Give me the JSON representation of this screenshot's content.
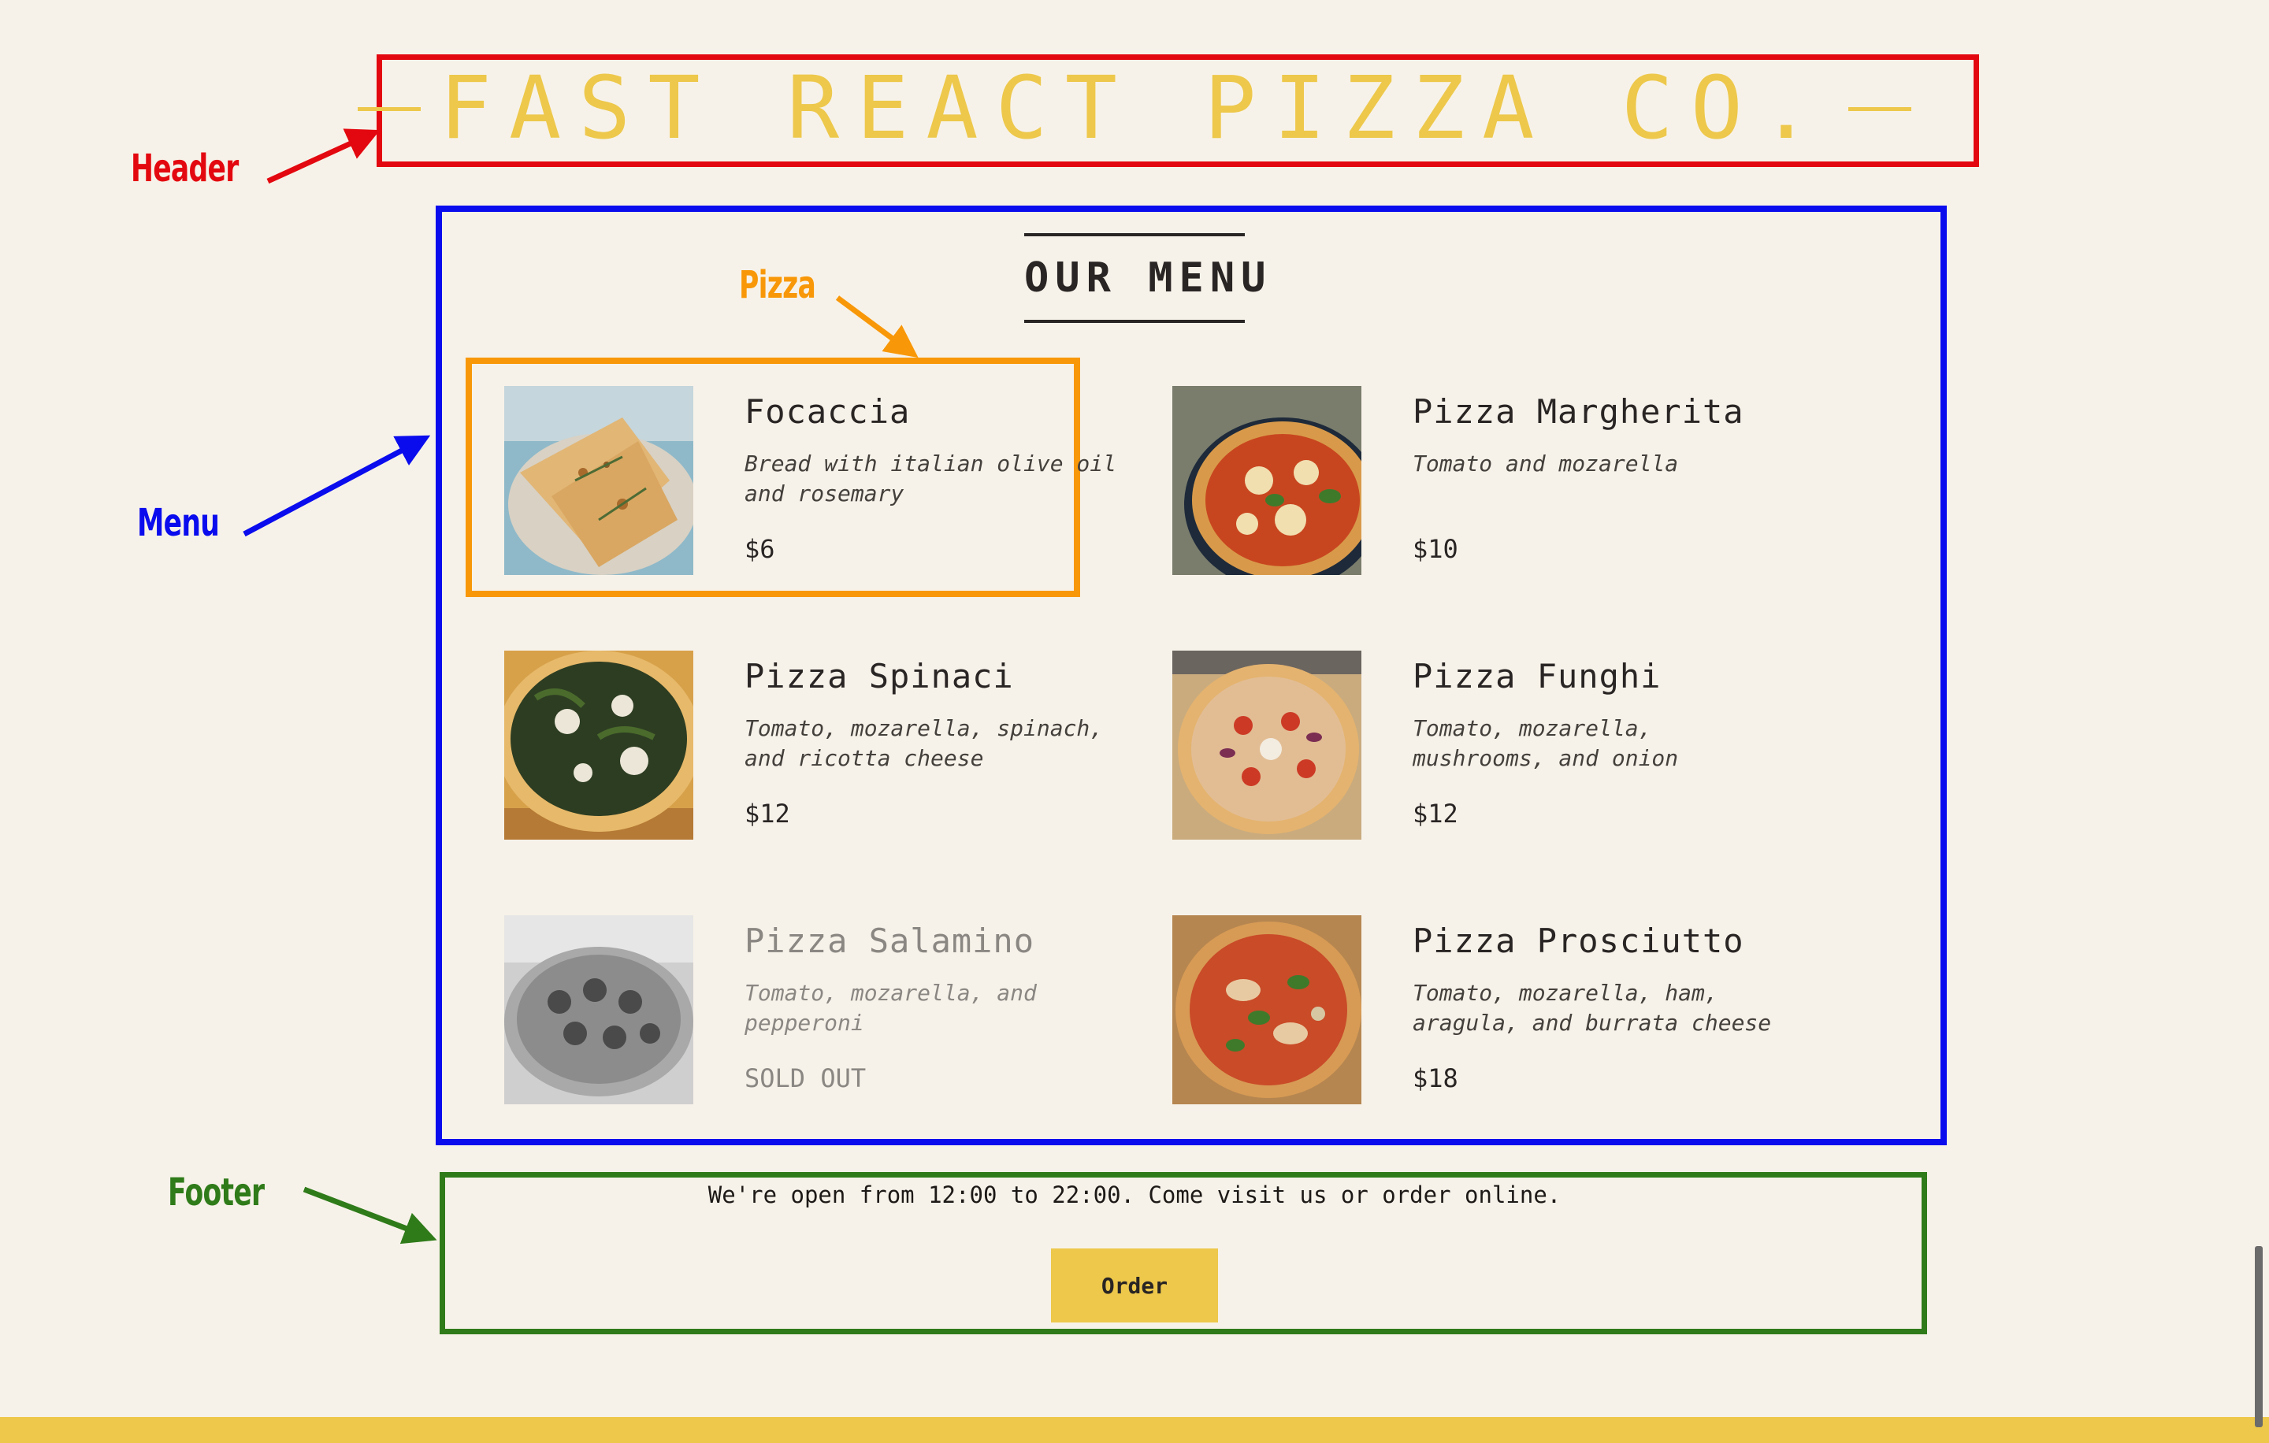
{
  "header": {
    "title": "FAST REACT PIZZA CO."
  },
  "menu": {
    "title": "OUR MENU",
    "items": [
      {
        "name": "Focaccia",
        "ingredients": "Bread with italian olive oil and rosemary",
        "price": "$6",
        "sold_out": false
      },
      {
        "name": "Pizza Margherita",
        "ingredients": "Tomato and mozarella",
        "price": "$10",
        "sold_out": false
      },
      {
        "name": "Pizza Spinaci",
        "ingredients": "Tomato, mozarella, spinach, and ricotta cheese",
        "price": "$12",
        "sold_out": false
      },
      {
        "name": "Pizza Funghi",
        "ingredients": "Tomato, mozarella, mushrooms, and onion",
        "price": "$12",
        "sold_out": false
      },
      {
        "name": "Pizza Salamino",
        "ingredients": "Tomato, mozarella, and pepperoni",
        "price": "SOLD OUT",
        "sold_out": true
      },
      {
        "name": "Pizza Prosciutto",
        "ingredients": "Tomato, mozarella, ham, aragula, and burrata cheese",
        "price": "$18",
        "sold_out": false
      }
    ]
  },
  "footer": {
    "text": "We're open from 12:00 to 22:00. Come visit us or order online.",
    "order_label": "Order"
  },
  "annotations": {
    "header": "Header",
    "menu": "Menu",
    "pizza": "Pizza",
    "footer": "Footer"
  },
  "colors": {
    "background": "#f7f2e9",
    "brand_yellow": "#edc84b",
    "annotation_header": "#e3080f",
    "annotation_menu": "#0a0cee",
    "annotation_pizza": "#f89808",
    "annotation_footer": "#2f7b1a"
  }
}
